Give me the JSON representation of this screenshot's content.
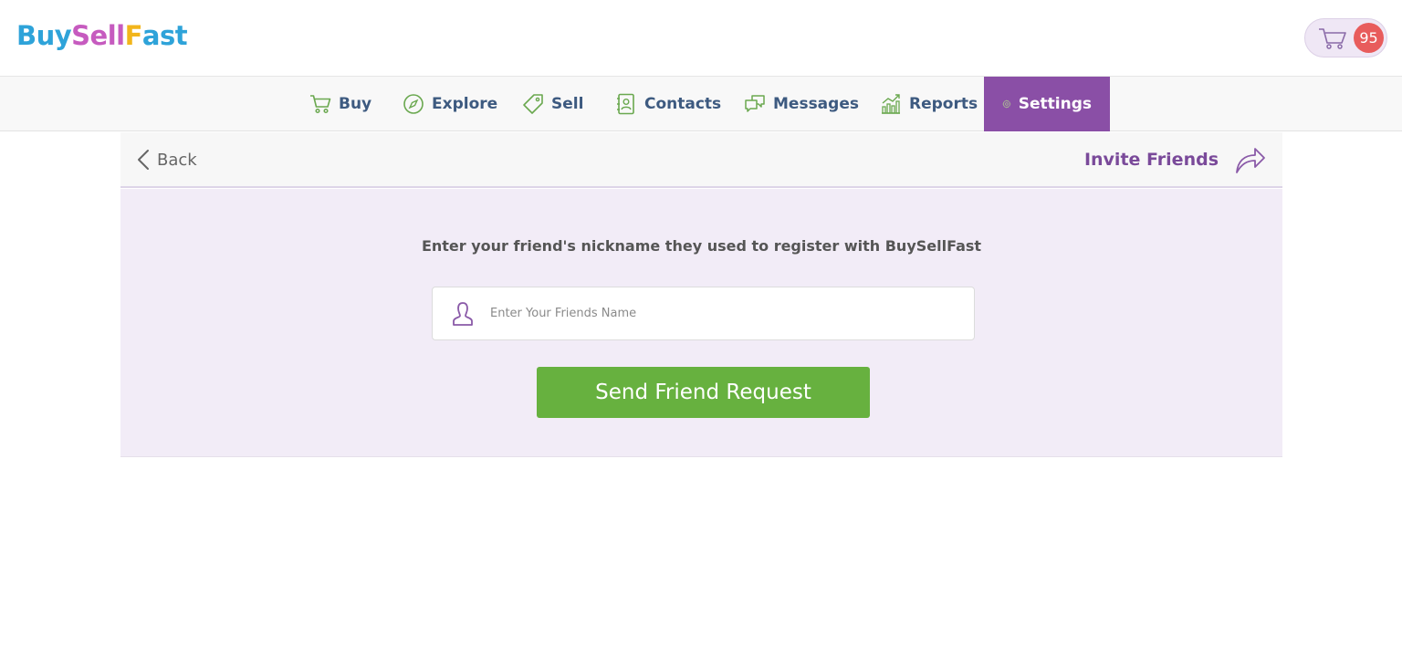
{
  "header": {
    "logo": {
      "parts": [
        {
          "text": "Buy",
          "color": "#2ea3d9"
        },
        {
          "text": "Sell",
          "color": "#c65bbf"
        },
        {
          "text": "F",
          "color": "#f2b51b"
        },
        {
          "text": "ast",
          "color": "#2ea3d9"
        }
      ]
    },
    "cart": {
      "icon": "cart-icon",
      "count": "95"
    }
  },
  "nav": {
    "items": [
      {
        "label": "Buy",
        "icon": "cart-icon"
      },
      {
        "label": "Explore",
        "icon": "compass-icon"
      },
      {
        "label": "Sell",
        "icon": "tag-icon"
      },
      {
        "label": "Contacts",
        "icon": "address-book-icon"
      },
      {
        "label": "Messages",
        "icon": "chat-icon"
      },
      {
        "label": "Reports",
        "icon": "chart-icon"
      },
      {
        "label": "Settings",
        "icon": "gear-icon",
        "active": true
      }
    ]
  },
  "subbar": {
    "back_label": "Back",
    "invite_label": "Invite Friends"
  },
  "form": {
    "prompt": "Enter your friend's nickname they used to register with BuySellFast",
    "input_placeholder": "Enter Your Friends Name",
    "input_value": "",
    "submit_label": "Send Friend Request"
  },
  "colors": {
    "accent_purple": "#8a4fa6",
    "nav_text": "#3d5a80",
    "icon_green": "#6aa84f",
    "button_green": "#67b13f",
    "badge_red": "#e85c5c"
  }
}
